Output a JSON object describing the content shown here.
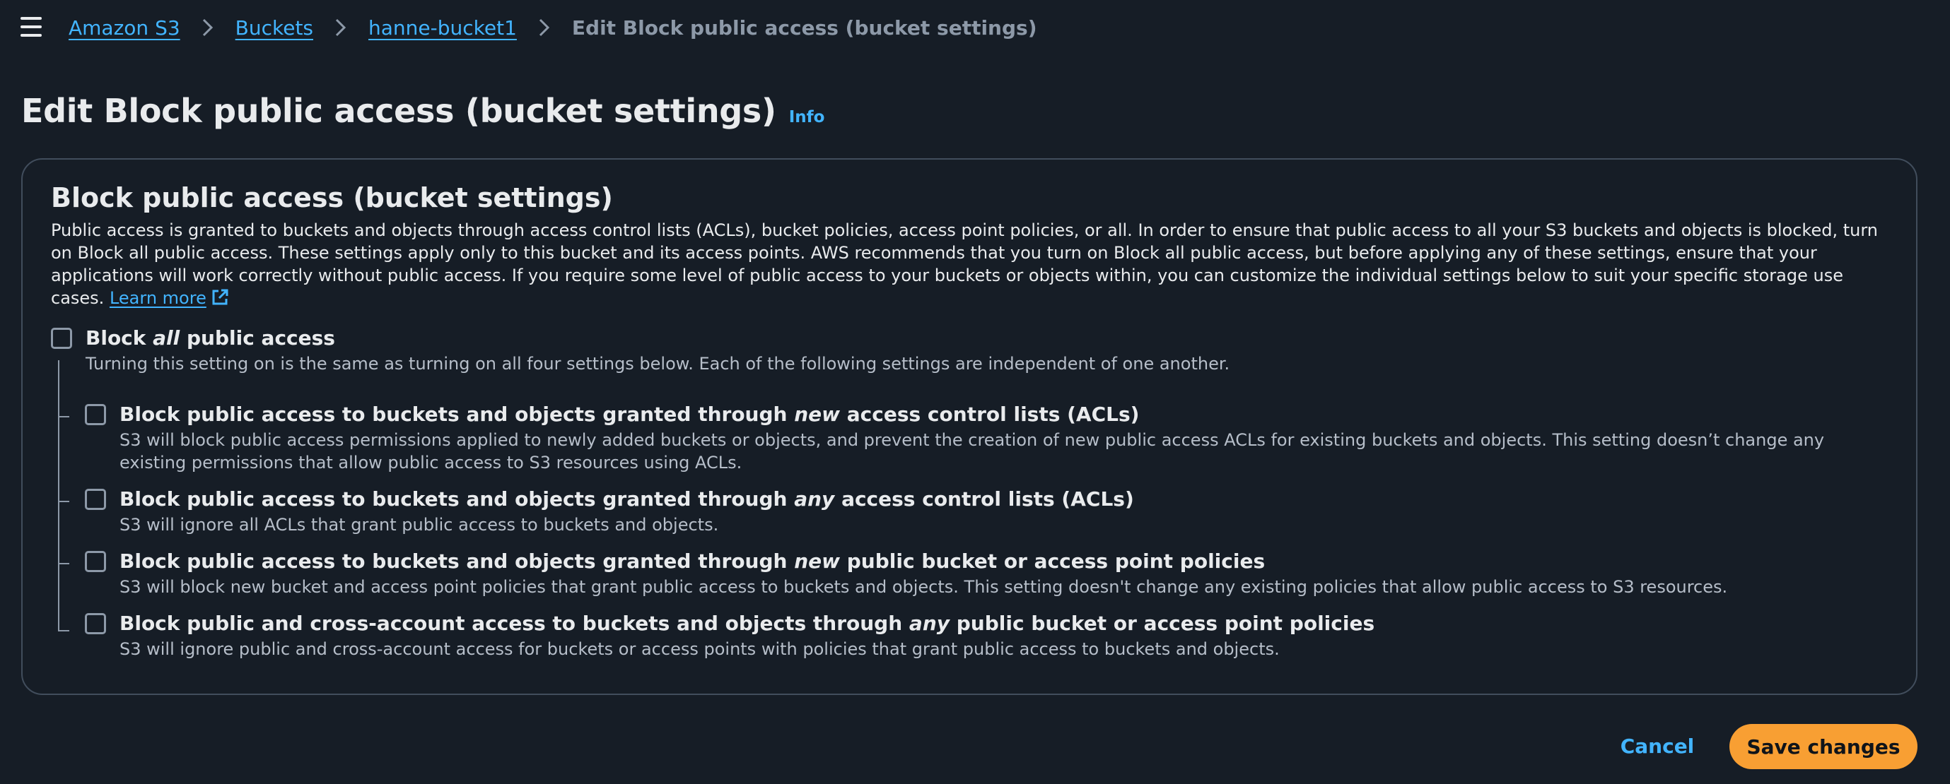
{
  "breadcrumb": {
    "items": [
      "Amazon S3",
      "Buckets",
      "hanne-bucket1"
    ],
    "current": "Edit Block public access (bucket settings)"
  },
  "page": {
    "title": "Edit Block public access (bucket settings)",
    "info_link": "Info"
  },
  "panel": {
    "title": "Block public access (bucket settings)",
    "description": "Public access is granted to buckets and objects through access control lists (ACLs), bucket policies, access point policies, or all. In order to ensure that public access to all your S3 buckets and objects is blocked, turn on Block all public access. These settings apply only to this bucket and its access points. AWS recommends that you turn on Block all public access, but before applying any of these settings, ensure that your applications will work correctly without public access. If you require some level of public access to your buckets or objects within, you can customize the individual settings below to suit your specific storage use cases.",
    "learn_more": "Learn more"
  },
  "block_all": {
    "label_pre": "Block",
    "label_em": "all",
    "label_post": "public access",
    "description": "Turning this setting on is the same as turning on all four settings below. Each of the following settings are independent of one another.",
    "checked": false
  },
  "options": [
    {
      "label_pre": "Block public access to buckets and objects granted through",
      "label_em": "new",
      "label_post": "access control lists (ACLs)",
      "description": "S3 will block public access permissions applied to newly added buckets or objects, and prevent the creation of new public access ACLs for existing buckets and objects. This setting doesn’t change any existing permissions that allow public access to S3 resources using ACLs.",
      "checked": false
    },
    {
      "label_pre": "Block public access to buckets and objects granted through",
      "label_em": "any",
      "label_post": "access control lists (ACLs)",
      "description": "S3 will ignore all ACLs that grant public access to buckets and objects.",
      "checked": false
    },
    {
      "label_pre": "Block public access to buckets and objects granted through",
      "label_em": "new",
      "label_post": "public bucket or access point policies",
      "description": "S3 will block new bucket and access point policies that grant public access to buckets and objects. This setting doesn't change any existing policies that allow public access to S3 resources.",
      "checked": false
    },
    {
      "label_pre": "Block public and cross-account access to buckets and objects through",
      "label_em": "any",
      "label_post": "public bucket or access point policies",
      "description": "S3 will ignore public and cross-account access for buckets or access points with policies that grant public access to buckets and objects.",
      "checked": false
    }
  ],
  "footer": {
    "cancel": "Cancel",
    "save": "Save changes"
  },
  "colors": {
    "background": "#161d26",
    "link": "#42b4ff",
    "primary_button": "#f89f33",
    "border": "#414d5c"
  },
  "icons": {
    "menu": "hamburger-menu-icon",
    "separator": "chevron-right-icon",
    "external": "external-link-icon"
  }
}
